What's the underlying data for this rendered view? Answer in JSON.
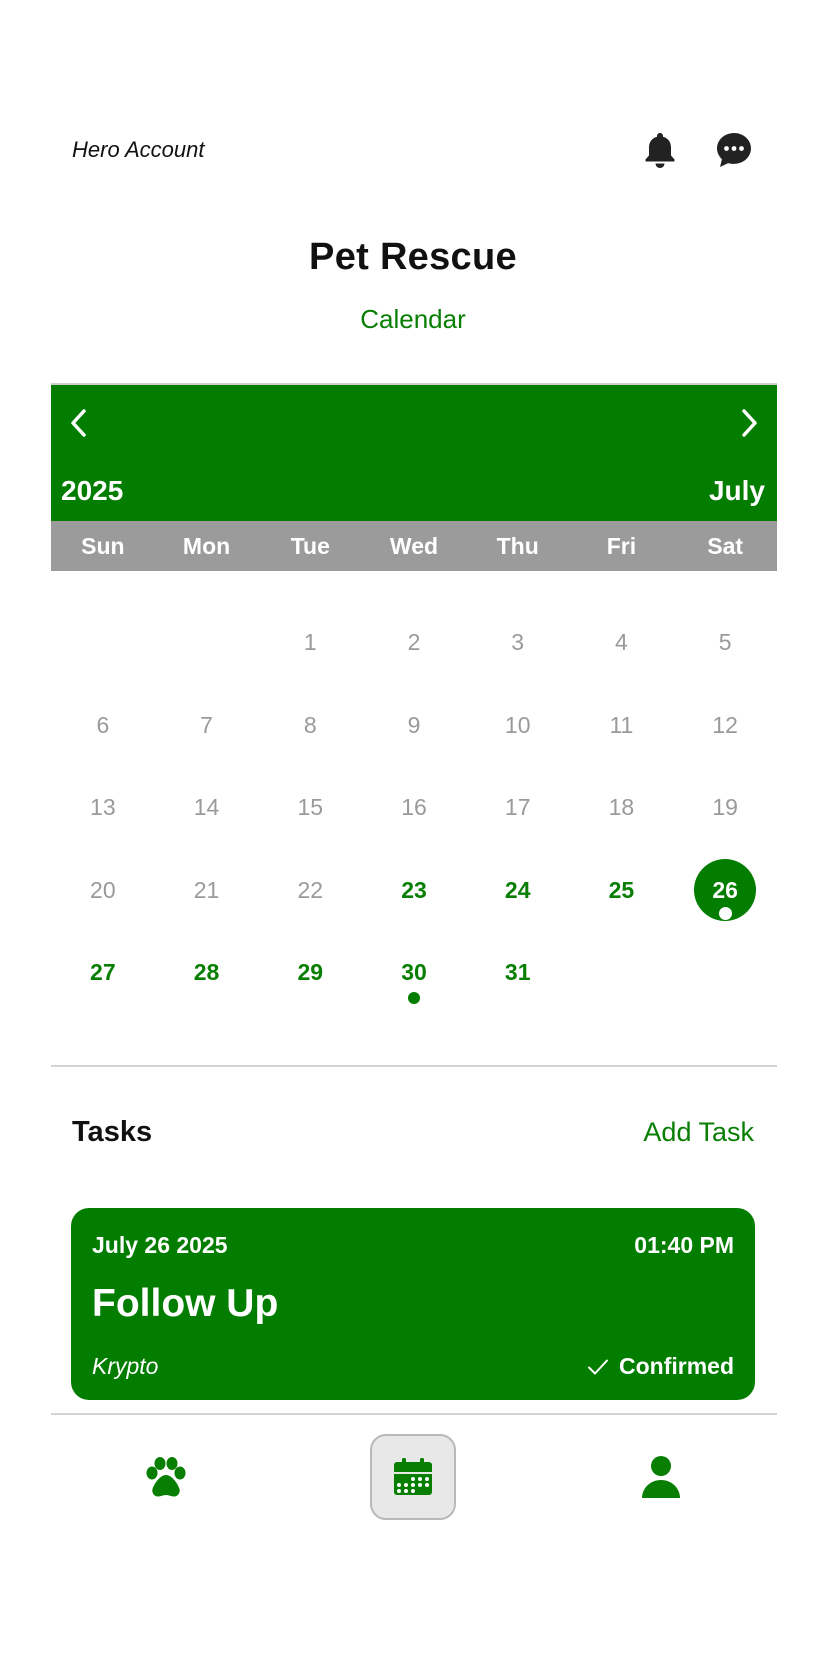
{
  "header": {
    "account_name": "Hero Account",
    "icons": [
      "bell-icon",
      "chat-bubble-icon"
    ]
  },
  "page": {
    "title": "Pet Rescue",
    "subtitle": "Calendar"
  },
  "calendar": {
    "year": "2025",
    "month": "July",
    "weekdays": [
      "Sun",
      "Mon",
      "Tue",
      "Wed",
      "Thu",
      "Fri",
      "Sat"
    ],
    "first_weekday_index": 2,
    "days_in_month": 31,
    "selected_day": 26,
    "first_future_day": 23,
    "days_with_events": [
      26,
      30
    ],
    "colors": {
      "accent": "#027d00",
      "past_day": "#9a9a9a",
      "weekday_bar": "#9b9b9b"
    }
  },
  "tasks": {
    "title": "Tasks",
    "add_label": "Add Task",
    "items": [
      {
        "date": "July 26 2025",
        "time": "01:40 PM",
        "title": "Follow Up",
        "pet": "Krypto",
        "status": "Confirmed"
      }
    ]
  },
  "bottom_nav": {
    "items": [
      "paw-icon",
      "calendar-icon",
      "person-icon"
    ],
    "active": "calendar-icon"
  }
}
